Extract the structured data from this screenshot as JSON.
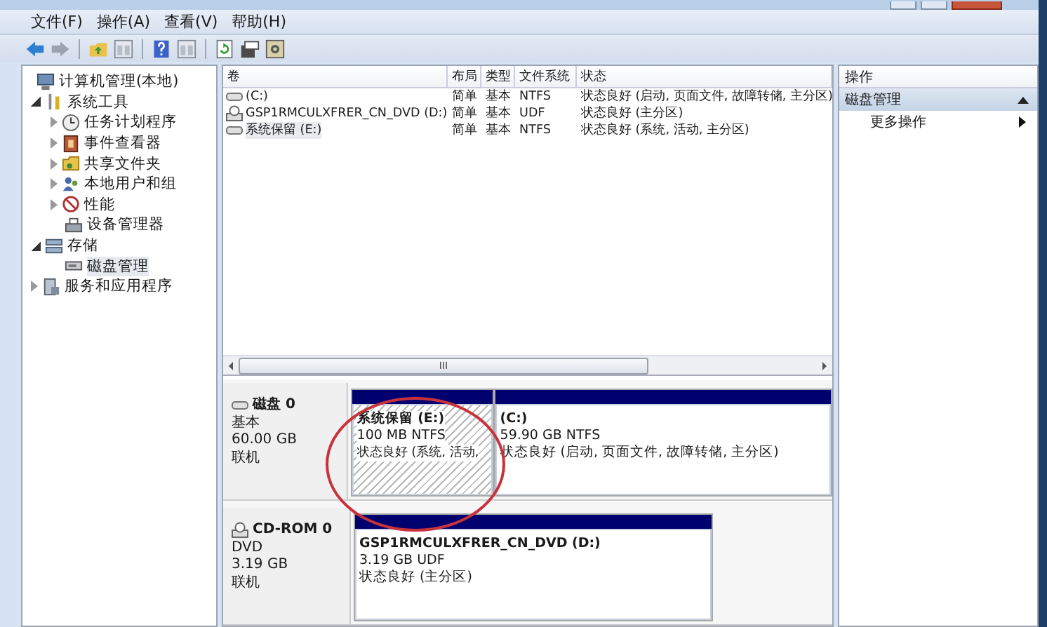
{
  "menu": [
    "文件(F)",
    "操作(A)",
    "查看(V)",
    "帮助(H)"
  ],
  "toolbar": [
    {
      "kind": "back"
    },
    {
      "kind": "forward"
    },
    {
      "kind": "sep"
    },
    {
      "kind": "up"
    },
    {
      "kind": "pane"
    },
    {
      "kind": "sep"
    },
    {
      "kind": "help"
    },
    {
      "kind": "pane"
    },
    {
      "kind": "sep"
    },
    {
      "kind": "refresh"
    },
    {
      "kind": "props"
    },
    {
      "kind": "settings"
    }
  ],
  "tree": [
    {
      "label": "计算机管理(本地)",
      "selected": false,
      "children": [
        {
          "label": "系统工具",
          "kind": "branch",
          "expanded": true,
          "selected": false,
          "children": [
            {
              "label": "任务计划程序",
              "kind": "branch",
              "expanded": false,
              "selected": false
            },
            {
              "label": "事件查看器",
              "kind": "branch",
              "expanded": false,
              "selected": false
            },
            {
              "label": "共享文件夹",
              "kind": "branch",
              "expanded": false,
              "selected": false
            },
            {
              "label": "本地用户和组",
              "kind": "branch",
              "expanded": false,
              "selected": false
            },
            {
              "label": "性能",
              "kind": "branch",
              "expanded": false,
              "selected": false
            },
            {
              "label": "设备管理器",
              "kind": "leaf",
              "selected": false
            }
          ]
        },
        {
          "label": "存储",
          "kind": "branch",
          "expanded": true,
          "selected": false,
          "children": [
            {
              "label": "磁盘管理",
              "kind": "leaf",
              "selected": true
            }
          ]
        },
        {
          "label": "服务和应用程序",
          "kind": "branch",
          "expanded": false,
          "selected": false
        }
      ]
    }
  ],
  "table": {
    "columns": [
      "卷",
      "布局",
      "类型",
      "文件系统",
      "状态"
    ],
    "rows": [
      {
        "kind": "disk",
        "selected": false,
        "cells": [
          "(C:)",
          "简单",
          "基本",
          "NTFS",
          "状态良好 (启动, 页面文件, 故障转储, 主分区)"
        ]
      },
      {
        "kind": "cd",
        "selected": false,
        "cells": [
          "GSP1RMCULXFRER_CN_DVD (D:)",
          "简单",
          "基本",
          "UDF",
          "状态良好 (主分区)"
        ]
      },
      {
        "kind": "disk",
        "selected": true,
        "cells": [
          "系统保留 (E:)",
          "简单",
          "基本",
          "NTFS",
          "状态良好 (系统, 活动, 主分区)"
        ]
      }
    ]
  },
  "scrollbar": {
    "thumb": "III"
  },
  "disks": [
    {
      "kind": "disk",
      "name": "磁盘 0",
      "type": "基本",
      "size": "60.00 GB",
      "status": "联机",
      "partitions": [
        {
          "title": "系统保留  (E:)",
          "size": "100 MB NTFS",
          "status": "状态良好 (系统, 活动,",
          "selected": true
        },
        {
          "title": "(C:)",
          "size": "59.90 GB NTFS",
          "status": "状态良好 (启动, 页面文件, 故障转储, 主分区)",
          "selected": false
        }
      ]
    },
    {
      "kind": "cd",
      "name": "CD-ROM 0",
      "type": "DVD",
      "size": "3.19 GB",
      "status": "联机",
      "partitions": [
        {
          "title": "GSP1RMCULXFRER_CN_DVD  (D:)",
          "size": "3.19 GB UDF",
          "status": "状态良好 (主分区)",
          "selected": false
        }
      ]
    }
  ],
  "actions": {
    "header": "操作",
    "section": {
      "title": "磁盘管理",
      "expanded": true
    },
    "items": [
      "更多操作"
    ]
  }
}
